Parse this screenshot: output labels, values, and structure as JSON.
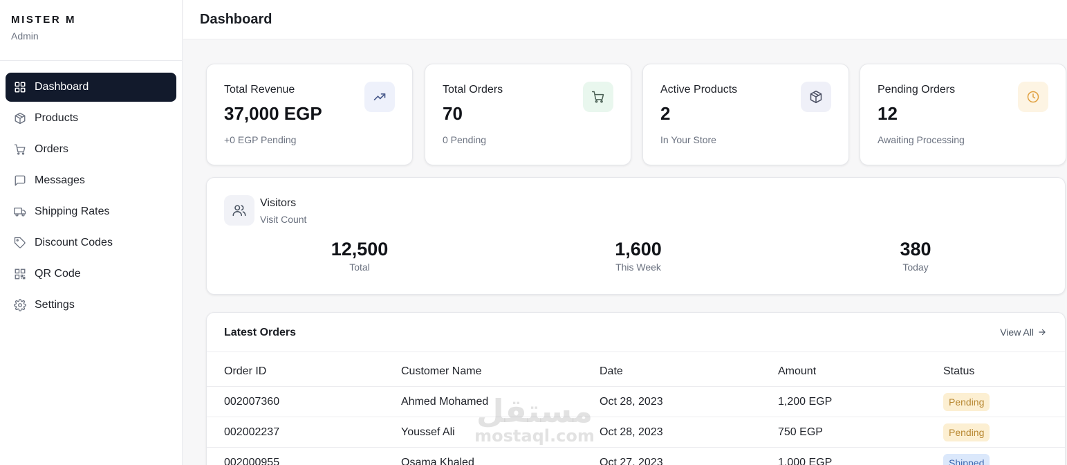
{
  "sidebar": {
    "brand": "MISTER M",
    "role": "Admin",
    "items": [
      {
        "label": "Dashboard",
        "icon": "grid-icon"
      },
      {
        "label": "Products",
        "icon": "box-icon"
      },
      {
        "label": "Orders",
        "icon": "cart-icon"
      },
      {
        "label": "Messages",
        "icon": "message-icon"
      },
      {
        "label": "Shipping Rates",
        "icon": "truck-icon"
      },
      {
        "label": "Discount Codes",
        "icon": "tag-icon"
      },
      {
        "label": "QR Code",
        "icon": "qr-code-icon"
      },
      {
        "label": "Settings",
        "icon": "gear-icon"
      }
    ]
  },
  "header": {
    "title": "Dashboard"
  },
  "stats": [
    {
      "label": "Total Revenue",
      "value": "37,000 EGP",
      "sub": "+0 EGP Pending",
      "icon": "trending-up-icon",
      "icon_bg": "#eef1fb",
      "icon_color": "#4a5b8c"
    },
    {
      "label": "Total Orders",
      "value": "70",
      "sub": "0 Pending",
      "icon": "cart-icon",
      "icon_bg": "#e9f7ee",
      "icon_color": "#4a5f54"
    },
    {
      "label": "Active Products",
      "value": "2",
      "sub": "In Your Store",
      "icon": "box-icon",
      "icon_bg": "#eff0f8",
      "icon_color": "#4b4f63"
    },
    {
      "label": "Pending Orders",
      "value": "12",
      "sub": "Awaiting Processing",
      "icon": "clock-icon",
      "icon_bg": "#fdf4e3",
      "icon_color": "#e0a040"
    }
  ],
  "visitors": {
    "title": "Visitors",
    "subtitle": "Visit Count",
    "stats": [
      {
        "value": "12,500",
        "label": "Total"
      },
      {
        "value": "1,600",
        "label": "This Week"
      },
      {
        "value": "380",
        "label": "Today"
      }
    ]
  },
  "orders": {
    "title": "Latest Orders",
    "view_all": "View All",
    "columns": [
      "Order ID",
      "Customer Name",
      "Date",
      "Amount",
      "Status"
    ],
    "rows": [
      {
        "id": "002007360",
        "customer": "Ahmed Mohamed",
        "date": "Oct 28, 2023",
        "amount": "1,200 EGP",
        "status": "Pending"
      },
      {
        "id": "002002237",
        "customer": "Youssef Ali",
        "date": "Oct 28, 2023",
        "amount": "750 EGP",
        "status": "Pending"
      },
      {
        "id": "002000955",
        "customer": "Osama Khaled",
        "date": "Oct 27, 2023",
        "amount": "1,000 EGP",
        "status": "Shipped"
      }
    ]
  },
  "status_colors": {
    "Pending": {
      "bg": "#fcefd2",
      "fg": "#b7862f"
    },
    "Shipped": {
      "bg": "#dbe8fb",
      "fg": "#3c67b0"
    }
  },
  "watermark": {
    "arabic": "مستقل",
    "latin": "mostaql.com"
  }
}
